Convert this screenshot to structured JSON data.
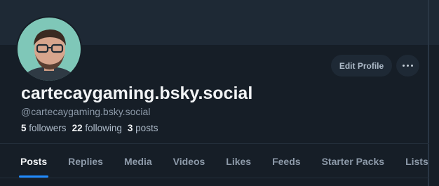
{
  "profile": {
    "display_name": "cartecaygaming.bsky.social",
    "handle": "@cartecaygaming.bsky.social",
    "followers_count": "5",
    "followers_label": "followers",
    "following_count": "22",
    "following_label": "following",
    "posts_count": "3",
    "posts_label": "posts"
  },
  "actions": {
    "edit_profile_label": "Edit Profile",
    "more_icon": "ellipsis-icon"
  },
  "tabs": [
    {
      "label": "Posts",
      "active": true
    },
    {
      "label": "Replies",
      "active": false
    },
    {
      "label": "Media",
      "active": false
    },
    {
      "label": "Videos",
      "active": false
    },
    {
      "label": "Likes",
      "active": false
    },
    {
      "label": "Feeds",
      "active": false
    },
    {
      "label": "Starter Packs",
      "active": false
    },
    {
      "label": "Lists",
      "active": false
    }
  ],
  "colors": {
    "background": "#161e27",
    "banner": "#1e2935",
    "accent": "#208bfe",
    "text_primary": "#f1f3f5",
    "text_secondary": "#8d9aa9"
  }
}
